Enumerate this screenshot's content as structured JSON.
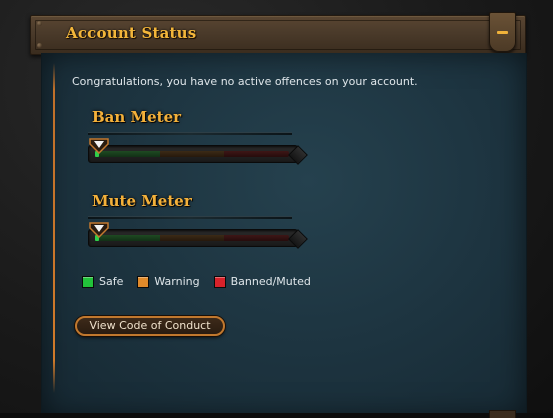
{
  "header": {
    "title": "Account Status",
    "collapse_icon": "minus-icon"
  },
  "panel": {
    "message": "Congratulations, you have no active offences on your account."
  },
  "meters": [
    {
      "title": "Ban Meter",
      "level": 0.0
    },
    {
      "title": "Mute Meter",
      "level": 0.0
    }
  ],
  "legend": [
    {
      "label": "Safe",
      "color": "#22c23a"
    },
    {
      "label": "Warning",
      "color": "#e08a2a"
    },
    {
      "label": "Banned/Muted",
      "color": "#d8222a"
    }
  ],
  "buttons": {
    "code_of_conduct": "View Code of Conduct"
  },
  "colors": {
    "accent": "#f3b63a",
    "button_border": "#c1782e",
    "panel_bg": "#1d3440"
  }
}
